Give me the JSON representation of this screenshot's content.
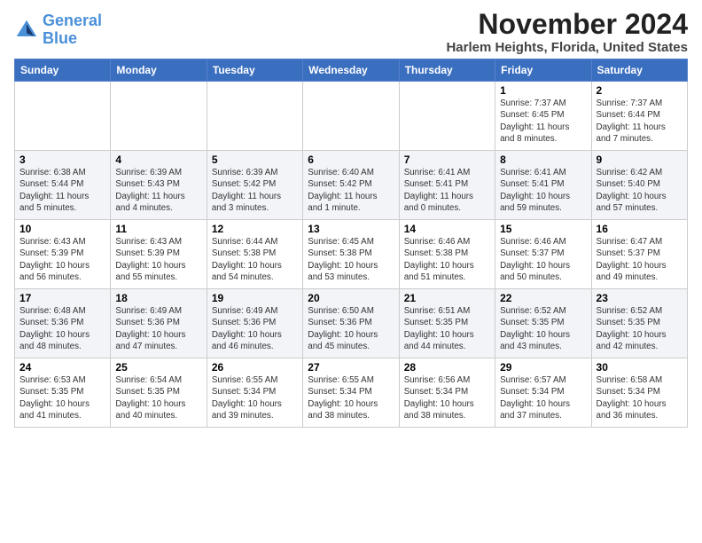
{
  "logo": {
    "line1": "General",
    "line2": "Blue"
  },
  "title": "November 2024",
  "location": "Harlem Heights, Florida, United States",
  "weekdays": [
    "Sunday",
    "Monday",
    "Tuesday",
    "Wednesday",
    "Thursday",
    "Friday",
    "Saturday"
  ],
  "weeks": [
    [
      {
        "day": "",
        "info": ""
      },
      {
        "day": "",
        "info": ""
      },
      {
        "day": "",
        "info": ""
      },
      {
        "day": "",
        "info": ""
      },
      {
        "day": "",
        "info": ""
      },
      {
        "day": "1",
        "info": "Sunrise: 7:37 AM\nSunset: 6:45 PM\nDaylight: 11 hours\nand 8 minutes."
      },
      {
        "day": "2",
        "info": "Sunrise: 7:37 AM\nSunset: 6:44 PM\nDaylight: 11 hours\nand 7 minutes."
      }
    ],
    [
      {
        "day": "3",
        "info": "Sunrise: 6:38 AM\nSunset: 5:44 PM\nDaylight: 11 hours\nand 5 minutes."
      },
      {
        "day": "4",
        "info": "Sunrise: 6:39 AM\nSunset: 5:43 PM\nDaylight: 11 hours\nand 4 minutes."
      },
      {
        "day": "5",
        "info": "Sunrise: 6:39 AM\nSunset: 5:42 PM\nDaylight: 11 hours\nand 3 minutes."
      },
      {
        "day": "6",
        "info": "Sunrise: 6:40 AM\nSunset: 5:42 PM\nDaylight: 11 hours\nand 1 minute."
      },
      {
        "day": "7",
        "info": "Sunrise: 6:41 AM\nSunset: 5:41 PM\nDaylight: 11 hours\nand 0 minutes."
      },
      {
        "day": "8",
        "info": "Sunrise: 6:41 AM\nSunset: 5:41 PM\nDaylight: 10 hours\nand 59 minutes."
      },
      {
        "day": "9",
        "info": "Sunrise: 6:42 AM\nSunset: 5:40 PM\nDaylight: 10 hours\nand 57 minutes."
      }
    ],
    [
      {
        "day": "10",
        "info": "Sunrise: 6:43 AM\nSunset: 5:39 PM\nDaylight: 10 hours\nand 56 minutes."
      },
      {
        "day": "11",
        "info": "Sunrise: 6:43 AM\nSunset: 5:39 PM\nDaylight: 10 hours\nand 55 minutes."
      },
      {
        "day": "12",
        "info": "Sunrise: 6:44 AM\nSunset: 5:38 PM\nDaylight: 10 hours\nand 54 minutes."
      },
      {
        "day": "13",
        "info": "Sunrise: 6:45 AM\nSunset: 5:38 PM\nDaylight: 10 hours\nand 53 minutes."
      },
      {
        "day": "14",
        "info": "Sunrise: 6:46 AM\nSunset: 5:38 PM\nDaylight: 10 hours\nand 51 minutes."
      },
      {
        "day": "15",
        "info": "Sunrise: 6:46 AM\nSunset: 5:37 PM\nDaylight: 10 hours\nand 50 minutes."
      },
      {
        "day": "16",
        "info": "Sunrise: 6:47 AM\nSunset: 5:37 PM\nDaylight: 10 hours\nand 49 minutes."
      }
    ],
    [
      {
        "day": "17",
        "info": "Sunrise: 6:48 AM\nSunset: 5:36 PM\nDaylight: 10 hours\nand 48 minutes."
      },
      {
        "day": "18",
        "info": "Sunrise: 6:49 AM\nSunset: 5:36 PM\nDaylight: 10 hours\nand 47 minutes."
      },
      {
        "day": "19",
        "info": "Sunrise: 6:49 AM\nSunset: 5:36 PM\nDaylight: 10 hours\nand 46 minutes."
      },
      {
        "day": "20",
        "info": "Sunrise: 6:50 AM\nSunset: 5:36 PM\nDaylight: 10 hours\nand 45 minutes."
      },
      {
        "day": "21",
        "info": "Sunrise: 6:51 AM\nSunset: 5:35 PM\nDaylight: 10 hours\nand 44 minutes."
      },
      {
        "day": "22",
        "info": "Sunrise: 6:52 AM\nSunset: 5:35 PM\nDaylight: 10 hours\nand 43 minutes."
      },
      {
        "day": "23",
        "info": "Sunrise: 6:52 AM\nSunset: 5:35 PM\nDaylight: 10 hours\nand 42 minutes."
      }
    ],
    [
      {
        "day": "24",
        "info": "Sunrise: 6:53 AM\nSunset: 5:35 PM\nDaylight: 10 hours\nand 41 minutes."
      },
      {
        "day": "25",
        "info": "Sunrise: 6:54 AM\nSunset: 5:35 PM\nDaylight: 10 hours\nand 40 minutes."
      },
      {
        "day": "26",
        "info": "Sunrise: 6:55 AM\nSunset: 5:34 PM\nDaylight: 10 hours\nand 39 minutes."
      },
      {
        "day": "27",
        "info": "Sunrise: 6:55 AM\nSunset: 5:34 PM\nDaylight: 10 hours\nand 38 minutes."
      },
      {
        "day": "28",
        "info": "Sunrise: 6:56 AM\nSunset: 5:34 PM\nDaylight: 10 hours\nand 38 minutes."
      },
      {
        "day": "29",
        "info": "Sunrise: 6:57 AM\nSunset: 5:34 PM\nDaylight: 10 hours\nand 37 minutes."
      },
      {
        "day": "30",
        "info": "Sunrise: 6:58 AM\nSunset: 5:34 PM\nDaylight: 10 hours\nand 36 minutes."
      }
    ]
  ]
}
